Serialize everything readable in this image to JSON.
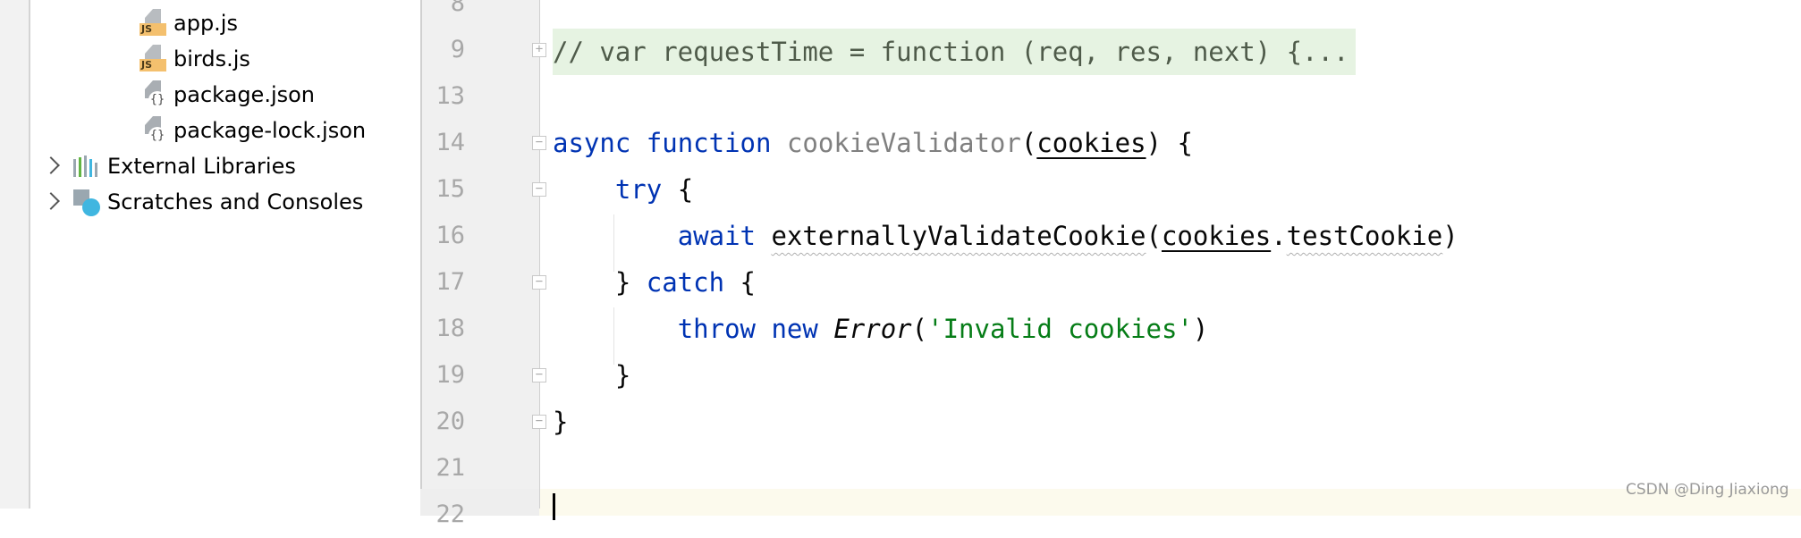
{
  "project_tree": {
    "items": [
      {
        "label": "app.js",
        "icon": "js-file-icon",
        "expandable": false
      },
      {
        "label": "birds.js",
        "icon": "js-file-icon",
        "expandable": false
      },
      {
        "label": "package.json",
        "icon": "json-file-icon",
        "expandable": false
      },
      {
        "label": "package-lock.json",
        "icon": "json-file-icon",
        "expandable": false
      },
      {
        "label": "External Libraries",
        "icon": "libraries-icon",
        "expandable": true
      },
      {
        "label": "Scratches and Consoles",
        "icon": "scratches-icon",
        "expandable": true
      }
    ]
  },
  "editor": {
    "lines": [
      {
        "number": "8",
        "fold": "",
        "tokens": []
      },
      {
        "number": "9",
        "fold": "expand",
        "collapsed": true,
        "tokens": [
          {
            "t": "// var requestTime = function (req, res, next) {...",
            "c": "#4f5b4a"
          }
        ]
      },
      {
        "number": "13",
        "fold": "",
        "tokens": []
      },
      {
        "number": "14",
        "fold": "collapse",
        "tokens": [
          {
            "t": "async",
            "c": "#0033b3"
          },
          {
            "t": " "
          },
          {
            "t": "function",
            "c": "#0033b3"
          },
          {
            "t": " "
          },
          {
            "t": "cookieValidator",
            "c": "#808080"
          },
          {
            "t": "("
          },
          {
            "t": "cookies",
            "u": true
          },
          {
            "t": ") {"
          }
        ]
      },
      {
        "number": "15",
        "fold": "collapse",
        "tokens": [
          {
            "t": "    "
          },
          {
            "t": "try",
            "c": "#0033b3"
          },
          {
            "t": " {"
          }
        ]
      },
      {
        "number": "16",
        "fold": "",
        "tokens": [
          {
            "t": "        "
          },
          {
            "t": "await",
            "c": "#0033b3"
          },
          {
            "t": " "
          },
          {
            "t": "externallyValidateCookie",
            "w": true
          },
          {
            "t": "("
          },
          {
            "t": "cookies",
            "u": true
          },
          {
            "t": "."
          },
          {
            "t": "testCookie",
            "w": true
          },
          {
            "t": ")"
          }
        ]
      },
      {
        "number": "17",
        "fold": "end",
        "tokens": [
          {
            "t": "    } "
          },
          {
            "t": "catch",
            "c": "#0033b3"
          },
          {
            "t": " {"
          }
        ]
      },
      {
        "number": "18",
        "fold": "",
        "tokens": [
          {
            "t": "        "
          },
          {
            "t": "throw",
            "c": "#0033b3"
          },
          {
            "t": " "
          },
          {
            "t": "new",
            "c": "#0033b3"
          },
          {
            "t": " "
          },
          {
            "t": "Error",
            "i": true
          },
          {
            "t": "("
          },
          {
            "t": "'Invalid cookies'",
            "c": "#067d17"
          },
          {
            "t": ")"
          }
        ]
      },
      {
        "number": "19",
        "fold": "end",
        "tokens": [
          {
            "t": "    }"
          }
        ]
      },
      {
        "number": "20",
        "fold": "end",
        "tokens": [
          {
            "t": "}"
          }
        ]
      },
      {
        "number": "21",
        "fold": "",
        "tokens": []
      },
      {
        "number": "22",
        "fold": "",
        "tokens": []
      }
    ]
  },
  "watermark": "CSDN @Ding Jiaxiong"
}
